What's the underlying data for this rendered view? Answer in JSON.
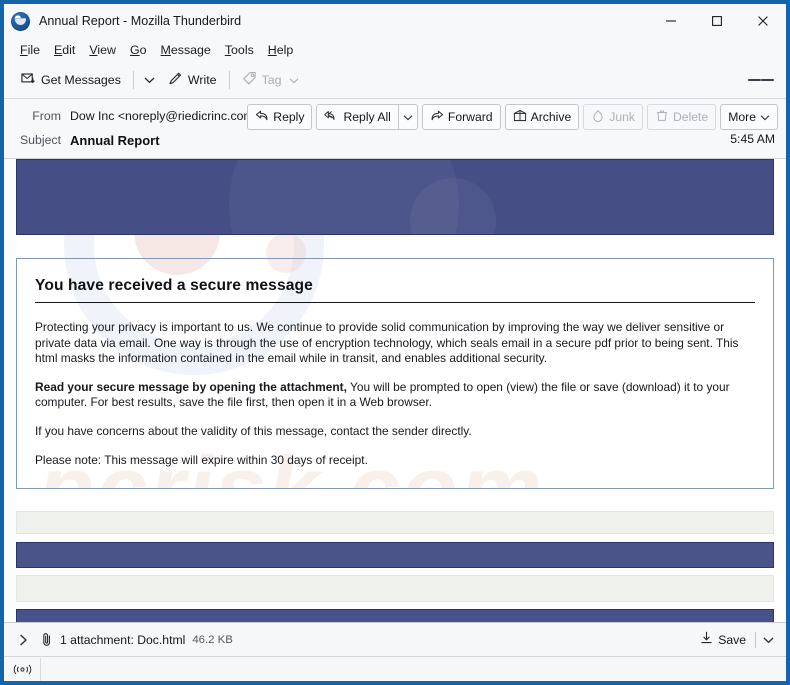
{
  "window": {
    "title": "Annual Report - Mozilla Thunderbird",
    "controls": {
      "minimize": "minimize-button",
      "maximize": "maximize-button",
      "close": "close-button"
    }
  },
  "menubar": {
    "items": [
      {
        "label": "File",
        "accel": "F"
      },
      {
        "label": "Edit",
        "accel": "E"
      },
      {
        "label": "View",
        "accel": "V"
      },
      {
        "label": "Go",
        "accel": "G"
      },
      {
        "label": "Message",
        "accel": "M"
      },
      {
        "label": "Tools",
        "accel": "T"
      },
      {
        "label": "Help",
        "accel": "H"
      }
    ]
  },
  "toolbar": {
    "get_messages_label": "Get Messages",
    "write_label": "Write",
    "tag_label": "Tag",
    "menu_label": "app-menu"
  },
  "message_header": {
    "from_label": "From",
    "from_value": "Dow Inc <noreply@riedicrinc.com>",
    "subject_label": "Subject",
    "subject_value": "Annual Report",
    "timestamp": "5:45 AM",
    "actions": [
      {
        "label": "Reply",
        "icon": "reply-icon",
        "disabled": false
      },
      {
        "label": "Reply All",
        "icon": "reply-all-icon",
        "disabled": false
      },
      {
        "label": "Forward",
        "icon": "forward-icon",
        "disabled": false
      },
      {
        "label": "Archive",
        "icon": "archive-icon",
        "disabled": false
      },
      {
        "label": "Junk",
        "icon": "junk-icon",
        "disabled": true
      },
      {
        "label": "Delete",
        "icon": "delete-icon",
        "disabled": true
      },
      {
        "label": "More",
        "icon": "chevron-down-icon",
        "disabled": false
      }
    ]
  },
  "email_body": {
    "watermark_text": "pcrisk.com",
    "heading": "You have received a secure message",
    "paragraph_1": "Protecting your privacy is important to us. We continue to provide solid communication by improving the way we deliver sensitive or private data via email. One way is through the use of encryption technology, which seals email in a secure pdf prior to being sent. This html masks the information contained in the email while in transit, and enables additional security.",
    "paragraph_2_bold": "Read your secure message by opening the attachment,",
    "paragraph_2_rest": " You will be prompted to open (view) the file or save (download) it to your computer. For best results, save the file first, then open it in a Web browser.",
    "paragraph_3": "If you have concerns about the validity of this message, contact the sender directly.",
    "paragraph_4": "Please note: This message will expire within 30 days of receipt.",
    "banner_color": "#454f85",
    "accent_color": "#48528a",
    "strip_color": "#eff1ed"
  },
  "attachment_bar": {
    "expander_icon": "chevron-right-icon",
    "paperclip_icon": "paperclip-icon",
    "label": "1 attachment: Doc.html",
    "size": "46.2 KB",
    "save_label": "Save",
    "save_dropdown_icon": "chevron-down-icon"
  },
  "status_bar": {
    "connection_icon": "offline-status-icon"
  }
}
